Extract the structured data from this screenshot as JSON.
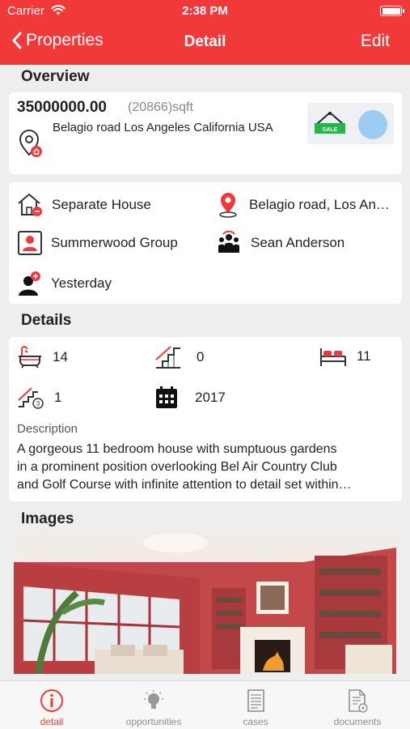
{
  "status_bar": {
    "carrier": "Carrier",
    "time": "2:38 PM"
  },
  "nav": {
    "back_label": "Properties",
    "title": "Detail",
    "edit_label": "Edit"
  },
  "sections": {
    "overview": "Overview",
    "details": "Details",
    "images": "Images"
  },
  "overview": {
    "price": "35000000.00",
    "area": "(20866)sqft",
    "address": "Belagio road Los Angeles California USA",
    "property_type": "Separate House",
    "location": "Belagio road, Los Angeles",
    "agency": "Summerwood Group",
    "agent": "Sean Anderson",
    "last_contact": "Yesterday"
  },
  "details": {
    "bathrooms": "14",
    "floors": "0",
    "bedrooms": "11",
    "levels": "1",
    "year_built": "2017",
    "description_label": "Description",
    "description_line1": "A gorgeous 11 bedroom house with sumptuous gardens",
    "description_line2": "in a prominent position overlooking Bel Air Country Club",
    "description_line3": "and Golf Course with infinite attention to detail set within…"
  },
  "tabs": [
    {
      "label": "detail",
      "icon": "info-icon",
      "active": true
    },
    {
      "label": "opportunities",
      "icon": "lightbulb-icon",
      "active": false
    },
    {
      "label": "cases",
      "icon": "document-icon",
      "active": false
    },
    {
      "label": "documents",
      "icon": "add-document-icon",
      "active": false
    }
  ],
  "colors": {
    "accent": "#f2393a",
    "background": "#eeeeee",
    "tab_inactive": "#8e8e8e"
  }
}
